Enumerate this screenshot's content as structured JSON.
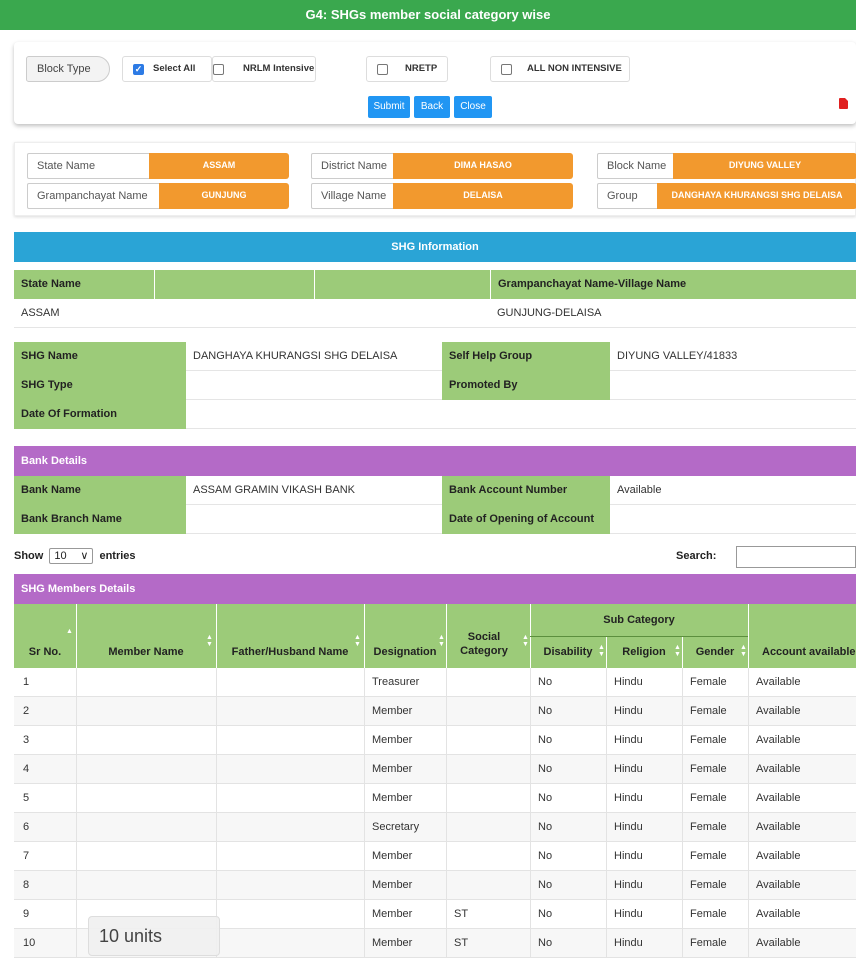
{
  "page_title": "G4: SHGs member social category wise",
  "filters": {
    "block_type_label": "Block Type",
    "options": [
      {
        "label": "Select All",
        "checked": true
      },
      {
        "label": "NRLM Intensive",
        "checked": false
      },
      {
        "label": "NRETP",
        "checked": false
      },
      {
        "label": "ALL NON INTENSIVE",
        "checked": false
      }
    ],
    "buttons": {
      "submit": "Submit",
      "back": "Back",
      "close": "Close"
    },
    "pdf_icon": "pdf-icon"
  },
  "location": {
    "state_label": "State Name",
    "state_value": "ASSAM",
    "district_label": "District Name",
    "district_value": "DIMA HASAO",
    "block_label": "Block Name",
    "block_value": "DIYUNG VALLEY",
    "gp_label": "Grampanchayat Name",
    "gp_value": "GUNJUNG",
    "village_label": "Village Name",
    "village_value": "DELAISA",
    "group_label": "Group",
    "group_value": "DANGHAYA KHURANGSI SHG DELAISA"
  },
  "shg_info": {
    "heading": "SHG Information",
    "state_name_label": "State Name",
    "gp_village_label": "Grampanchayat Name-Village Name",
    "state_value": "ASSAM",
    "gp_village_value": "GUNJUNG-DELAISA",
    "shg_name_label": "SHG Name",
    "shg_name_value": "DANGHAYA KHURANGSI SHG DELAISA",
    "self_help_group_label": "Self Help Group",
    "self_help_group_value": "DIYUNG VALLEY/41833",
    "shg_type_label": "SHG Type",
    "promoted_by_label": "Promoted By",
    "date_of_formation_label": "Date Of Formation"
  },
  "bank": {
    "heading": "Bank Details",
    "bank_name_label": "Bank Name",
    "bank_name_value": "ASSAM GRAMIN VIKASH BANK",
    "account_number_label": "Bank Account Number",
    "account_number_value": "Available",
    "branch_label": "Bank Branch Name",
    "opening_date_label": "Date of Opening of Account"
  },
  "table_controls": {
    "show_label": "Show",
    "entries_value": "10",
    "entries_label": "entries",
    "search_label": "Search:"
  },
  "members": {
    "heading": "SHG Members Details",
    "columns": {
      "sr": "Sr No.",
      "member": "Member Name",
      "father": "Father/Husband Name",
      "designation": "Designation",
      "social": "Social Category",
      "sub_category": "Sub Category",
      "disability": "Disability",
      "religion": "Religion",
      "gender": "Gender",
      "account": "Account available"
    },
    "rows": [
      {
        "sr": "1",
        "member": "",
        "father": "",
        "designation": "Treasurer",
        "social": "",
        "disability": "No",
        "religion": "Hindu",
        "gender": "Female",
        "account": "Available"
      },
      {
        "sr": "2",
        "member": "",
        "father": "",
        "designation": "Member",
        "social": "",
        "disability": "No",
        "religion": "Hindu",
        "gender": "Female",
        "account": "Available"
      },
      {
        "sr": "3",
        "member": "",
        "father": "",
        "designation": "Member",
        "social": "",
        "disability": "No",
        "religion": "Hindu",
        "gender": "Female",
        "account": "Available"
      },
      {
        "sr": "4",
        "member": "",
        "father": "",
        "designation": "Member",
        "social": "",
        "disability": "No",
        "religion": "Hindu",
        "gender": "Female",
        "account": "Available"
      },
      {
        "sr": "5",
        "member": "",
        "father": "",
        "designation": "Member",
        "social": "",
        "disability": "No",
        "religion": "Hindu",
        "gender": "Female",
        "account": "Available"
      },
      {
        "sr": "6",
        "member": "",
        "father": "",
        "designation": "Secretary",
        "social": "",
        "disability": "No",
        "religion": "Hindu",
        "gender": "Female",
        "account": "Available"
      },
      {
        "sr": "7",
        "member": "",
        "father": "",
        "designation": "Member",
        "social": "",
        "disability": "No",
        "religion": "Hindu",
        "gender": "Female",
        "account": "Available"
      },
      {
        "sr": "8",
        "member": "",
        "father": "",
        "designation": "Member",
        "social": "",
        "disability": "No",
        "religion": "Hindu",
        "gender": "Female",
        "account": "Available"
      },
      {
        "sr": "9",
        "member": "",
        "father": "",
        "designation": "Member",
        "social": "ST",
        "disability": "No",
        "religion": "Hindu",
        "gender": "Female",
        "account": "Available"
      },
      {
        "sr": "10",
        "member": "",
        "father": "",
        "designation": "Member",
        "social": "ST",
        "disability": "No",
        "religion": "Hindu",
        "gender": "Female",
        "account": "Available"
      }
    ]
  },
  "toast": "10 units",
  "colors": {
    "title_green": "#3aa84e",
    "orange": "#f2992e",
    "blue_header": "#2aa4d6",
    "purple_header": "#b46ac7",
    "label_green": "#9ccb79",
    "button_blue": "#2196f3"
  }
}
